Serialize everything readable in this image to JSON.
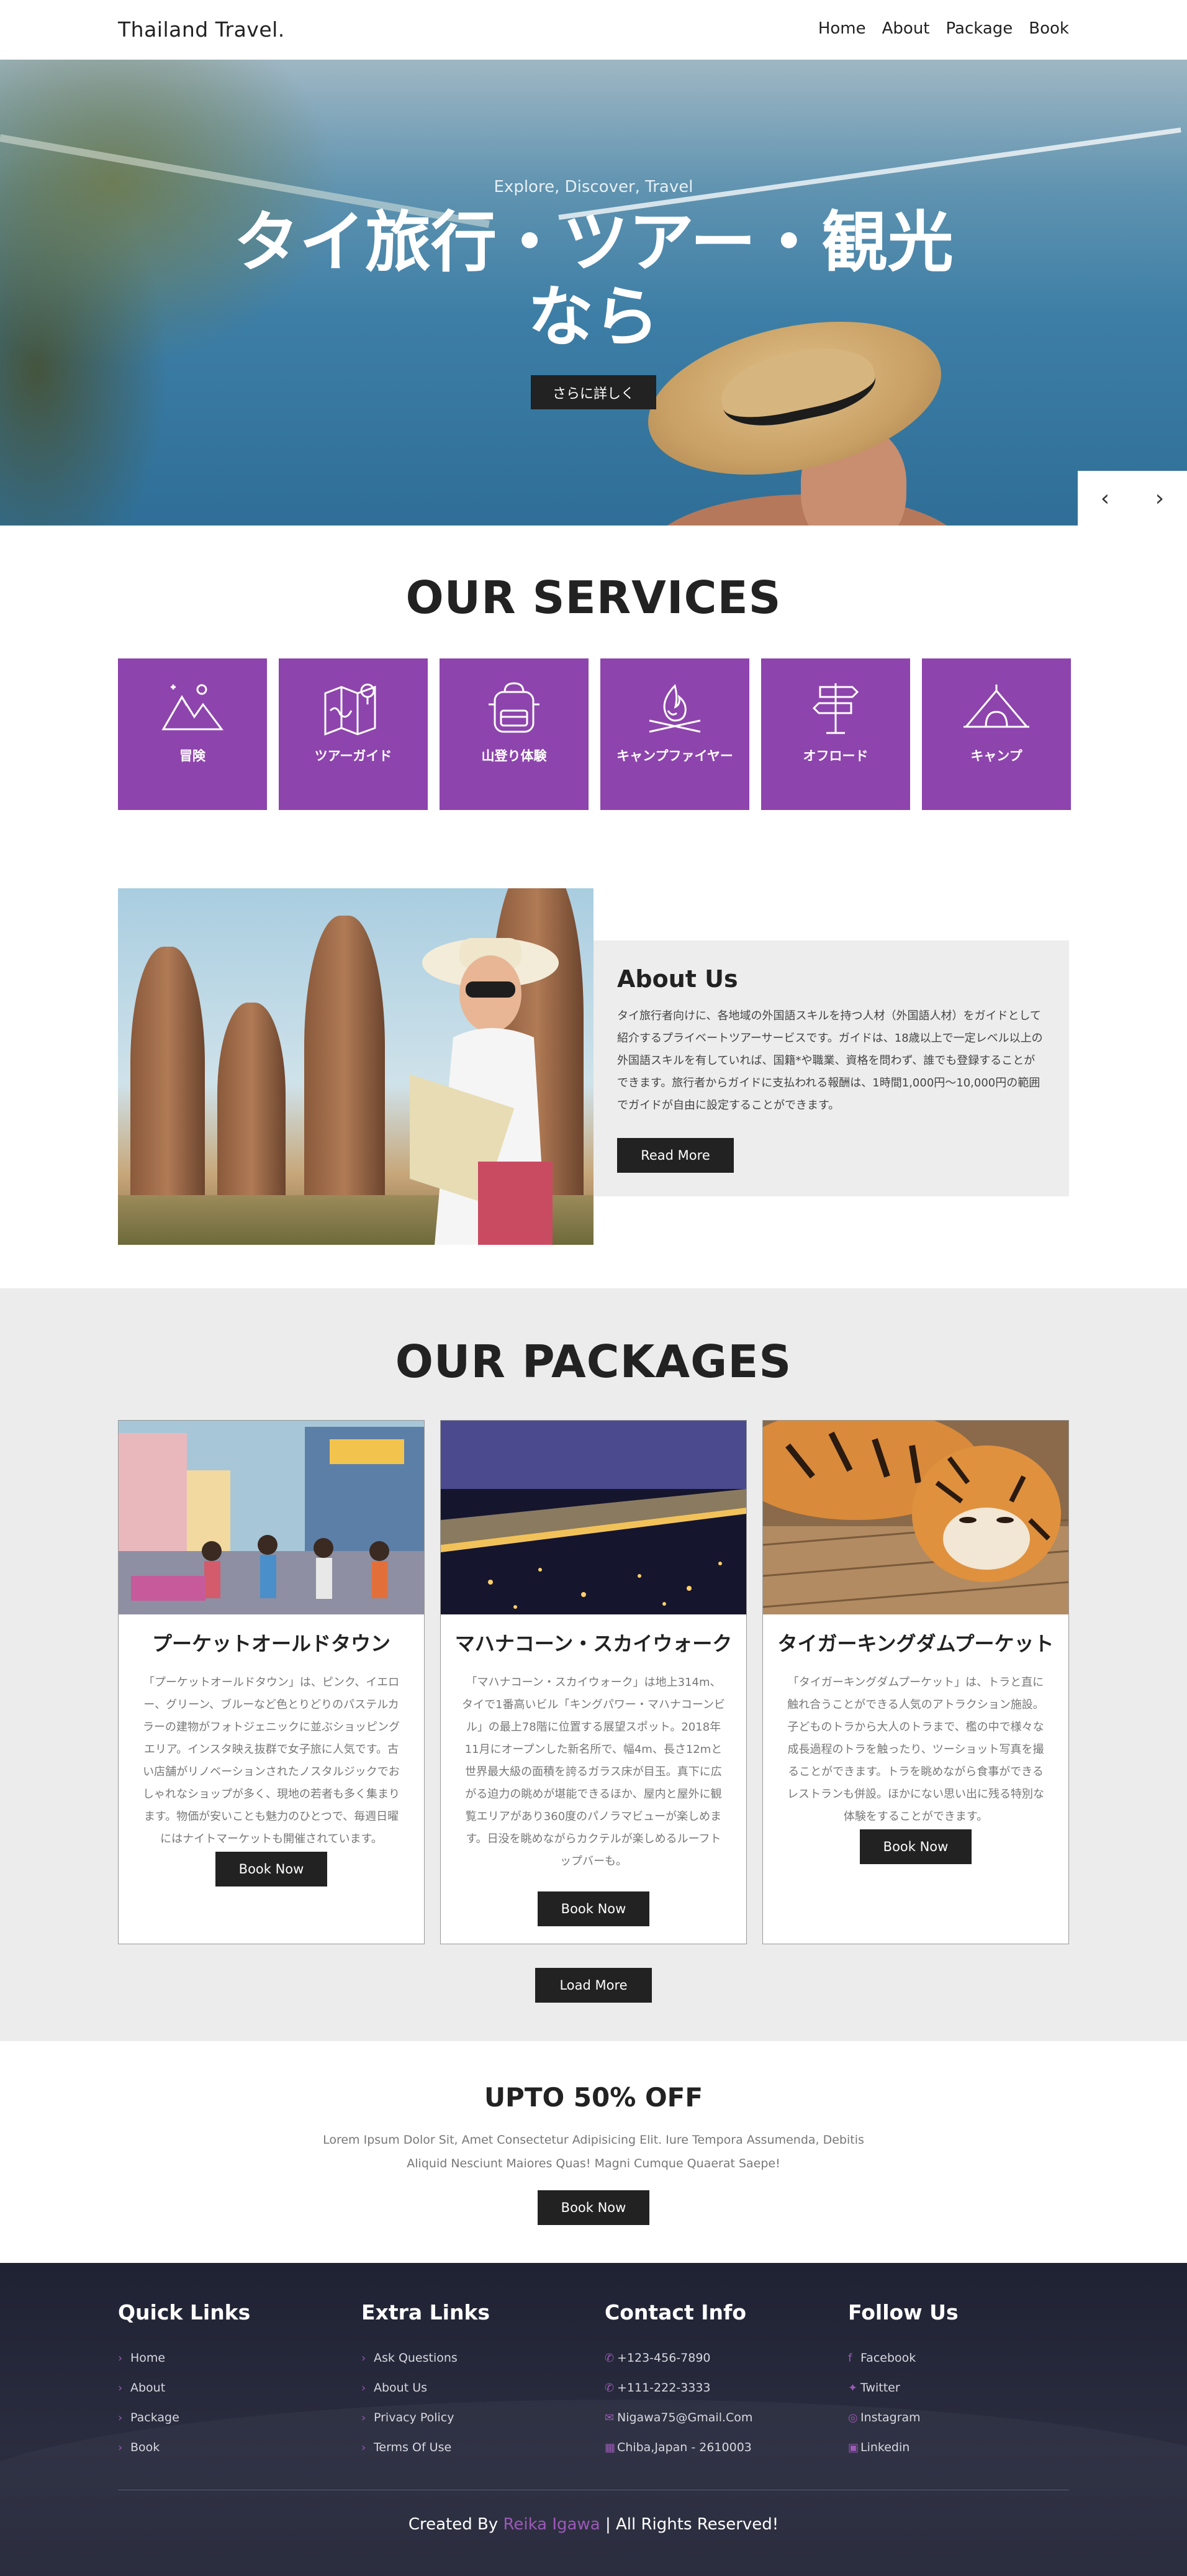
{
  "header": {
    "logo": "Thailand Travel.",
    "nav": [
      "Home",
      "About",
      "Package",
      "Book"
    ]
  },
  "hero": {
    "subtitle": "Explore, Discover, Travel",
    "title": "タイ旅行・ツアー・観光なら",
    "button": "さらに詳しく",
    "prev_icon": "‹",
    "next_icon": "›"
  },
  "services": {
    "title": "OUR SERVICES",
    "items": [
      {
        "label": "冒険",
        "icon": "mountain-icon"
      },
      {
        "label": "ツアーガイド",
        "icon": "map-icon"
      },
      {
        "label": "山登り体験",
        "icon": "backpack-icon"
      },
      {
        "label": "キャンプファイヤー",
        "icon": "campfire-icon"
      },
      {
        "label": "オフロード",
        "icon": "signpost-icon"
      },
      {
        "label": "キャンプ",
        "icon": "tent-icon"
      }
    ]
  },
  "about": {
    "title": "About Us",
    "text": "タイ旅行者向けに、各地域の外国語スキルを持つ人材（外国語人材）をガイドとして紹介するプライベートツアーサービスです。ガイドは、18歳以上で一定レベル以上の外国語スキルを有していれば、国籍*や職業、資格を問わず、誰でも登録することができます。旅行者からガイドに支払われる報酬は、1時間1,000円〜10,000円の範囲でガイドが自由に設定することができます。",
    "button": "Read More"
  },
  "packages": {
    "title": "OUR PACKAGES",
    "items": [
      {
        "title": "プーケットオールドタウン",
        "text": "「プーケットオールドタウン」は、ピンク、イエロー、グリーン、ブルーなど色とりどりのパステルカラーの建物がフォトジェニックに並ぶショッピングエリア。インスタ映え抜群で女子旅に人気です。古い店舗がリノベーションされたノスタルジックでおしゃれなショップが多く、現地の若者も多く集まります。物価が安いことも魅力のひとつで、毎週日曜にはナイトマーケットも開催されています。",
        "button": "Book Now"
      },
      {
        "title": "マハナコーン・スカイウォーク",
        "text": "「マハナコーン・スカイウォーク」は地上314m、タイで1番高いビル「キングパワー・マハナコーンビル」の最上78階に位置する展望スポット。2018年11月にオープンした新名所で、幅4m、長さ12mと世界最大級の面積を誇るガラス床が目玉。真下に広がる迫力の眺めが堪能できるほか、屋内と屋外に観覧エリアがあり360度のパノラマビューが楽しめます。日没を眺めながらカクテルが楽しめるルーフトップバーも。",
        "button": "Book Now"
      },
      {
        "title": "タイガーキングダムプーケット",
        "text": "「タイガーキングダムプーケット」は、トラと直に触れ合うことができる人気のアトラクション施設。子どものトラから大人のトラまで、檻の中で様々な成長過程のトラを触ったり、ツーショット写真を撮ることができます。トラを眺めながら食事ができるレストランも併設。ほかにない思い出に残る特別な体験をすることができます。",
        "button": "Book Now"
      }
    ],
    "load_more": "Load More"
  },
  "offer": {
    "title": "UPTO 50% OFF",
    "text": "Lorem Ipsum Dolor Sit, Amet Consectetur Adipisicing Elit. Iure Tempora Assumenda, Debitis Aliquid Nesciunt Maiores Quas! Magni Cumque Quaerat Saepe!",
    "button": "Book Now"
  },
  "footer": {
    "quick_links": {
      "title": "Quick Links",
      "items": [
        "Home",
        "About",
        "Package",
        "Book"
      ]
    },
    "extra_links": {
      "title": "Extra Links",
      "items": [
        "Ask Questions",
        "About Us",
        "Privacy Policy",
        "Terms Of Use"
      ]
    },
    "contact": {
      "title": "Contact Info",
      "items": [
        {
          "icon": "phone-icon",
          "text": "+123-456-7890"
        },
        {
          "icon": "phone-icon",
          "text": "+111-222-3333"
        },
        {
          "icon": "envelope-icon",
          "text": "Nigawa75@Gmail.Com"
        },
        {
          "icon": "map-icon",
          "text": "Chiba,Japan - 2610003"
        }
      ]
    },
    "follow": {
      "title": "Follow Us",
      "items": [
        {
          "icon": "facebook-icon",
          "text": "Facebook"
        },
        {
          "icon": "twitter-icon",
          "text": "Twitter"
        },
        {
          "icon": "instagram-icon",
          "text": "Instagram"
        },
        {
          "icon": "linkedin-icon",
          "text": "Linkedin"
        }
      ]
    },
    "credit_prefix": "Created By",
    "credit_name": "Reika Igawa",
    "credit_suffix": "| All Rights Reserved!"
  },
  "colors": {
    "accent": "#8e44ad",
    "dark": "#222222",
    "footer_bg": "#242738",
    "section_bg": "#ececec"
  }
}
